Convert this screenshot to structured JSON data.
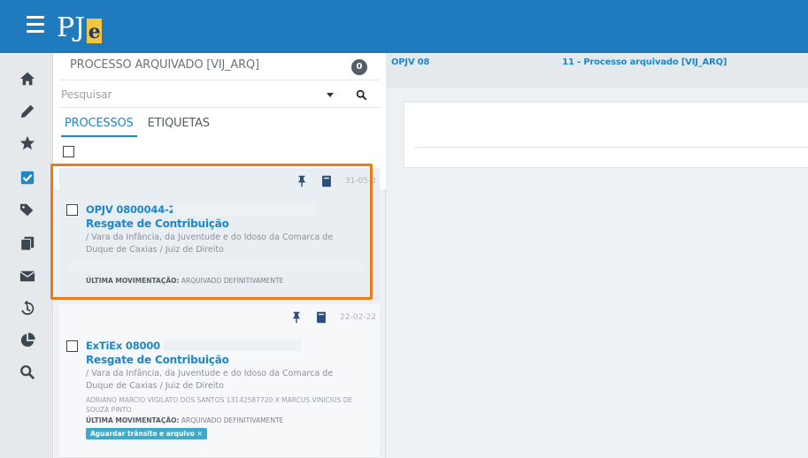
{
  "topbar": {
    "logo_text": "PJ",
    "logo_letter": "e"
  },
  "sidebar": {
    "icons": [
      "home-icon",
      "pencil-icon",
      "star-icon",
      "checkbox-icon",
      "tags-icon",
      "documents-icon",
      "envelope-icon",
      "history-icon",
      "chart-icon",
      "search-icon"
    ]
  },
  "list": {
    "task_name": "PROCESSO ARQUIVADO [VIJ_ARQ]",
    "count": "0",
    "search_placeholder": "Pesquisar",
    "tabs": [
      "PROCESSOS",
      "ETIQUETAS"
    ],
    "cards": [
      {
        "date": "31-05-2",
        "number": "OPJV 0800044-2",
        "subject": "Resgate de Contribuição",
        "org": "/ Vara da Infância, da Juventude e do Idoso da Comarca de Duque de Caxias / Juiz de Direito",
        "last_mov_label": "ÚLTIMA MOVIMENTAÇÃO:",
        "last_mov_value": "ARQUIVADO DEFINITIVAMENTE"
      },
      {
        "date": "22-02-22",
        "number": "ExTiEx 08000",
        "subject": "Resgate de Contribuição",
        "org": "/ Vara da Infância, da Juventude e do Idoso da Comarca de Duque de Caxias / Juiz de Direito",
        "parties": "ADRIANO MARCIO VIGILATO DOS SANTOS 13142587720 X MARCUS VINICIUS DE SOUZA PINTO",
        "last_mov_label": "ÚLTIMA MOVIMENTAÇÃO:",
        "last_mov_value": "ARQUIVADO DEFINITIVAMENTE",
        "tag": "Aguardar trânsito e arquivo ✕"
      }
    ]
  },
  "detail": {
    "title_prefix": "OPJV 08",
    "title_suffix": "11 - Processo arquivado [VIJ_ARQ]"
  },
  "colors": {
    "topbar": "#1f7bbd",
    "link": "#1f86c7",
    "highlight": "#e97a1e",
    "tag": "#3fa9c9"
  }
}
